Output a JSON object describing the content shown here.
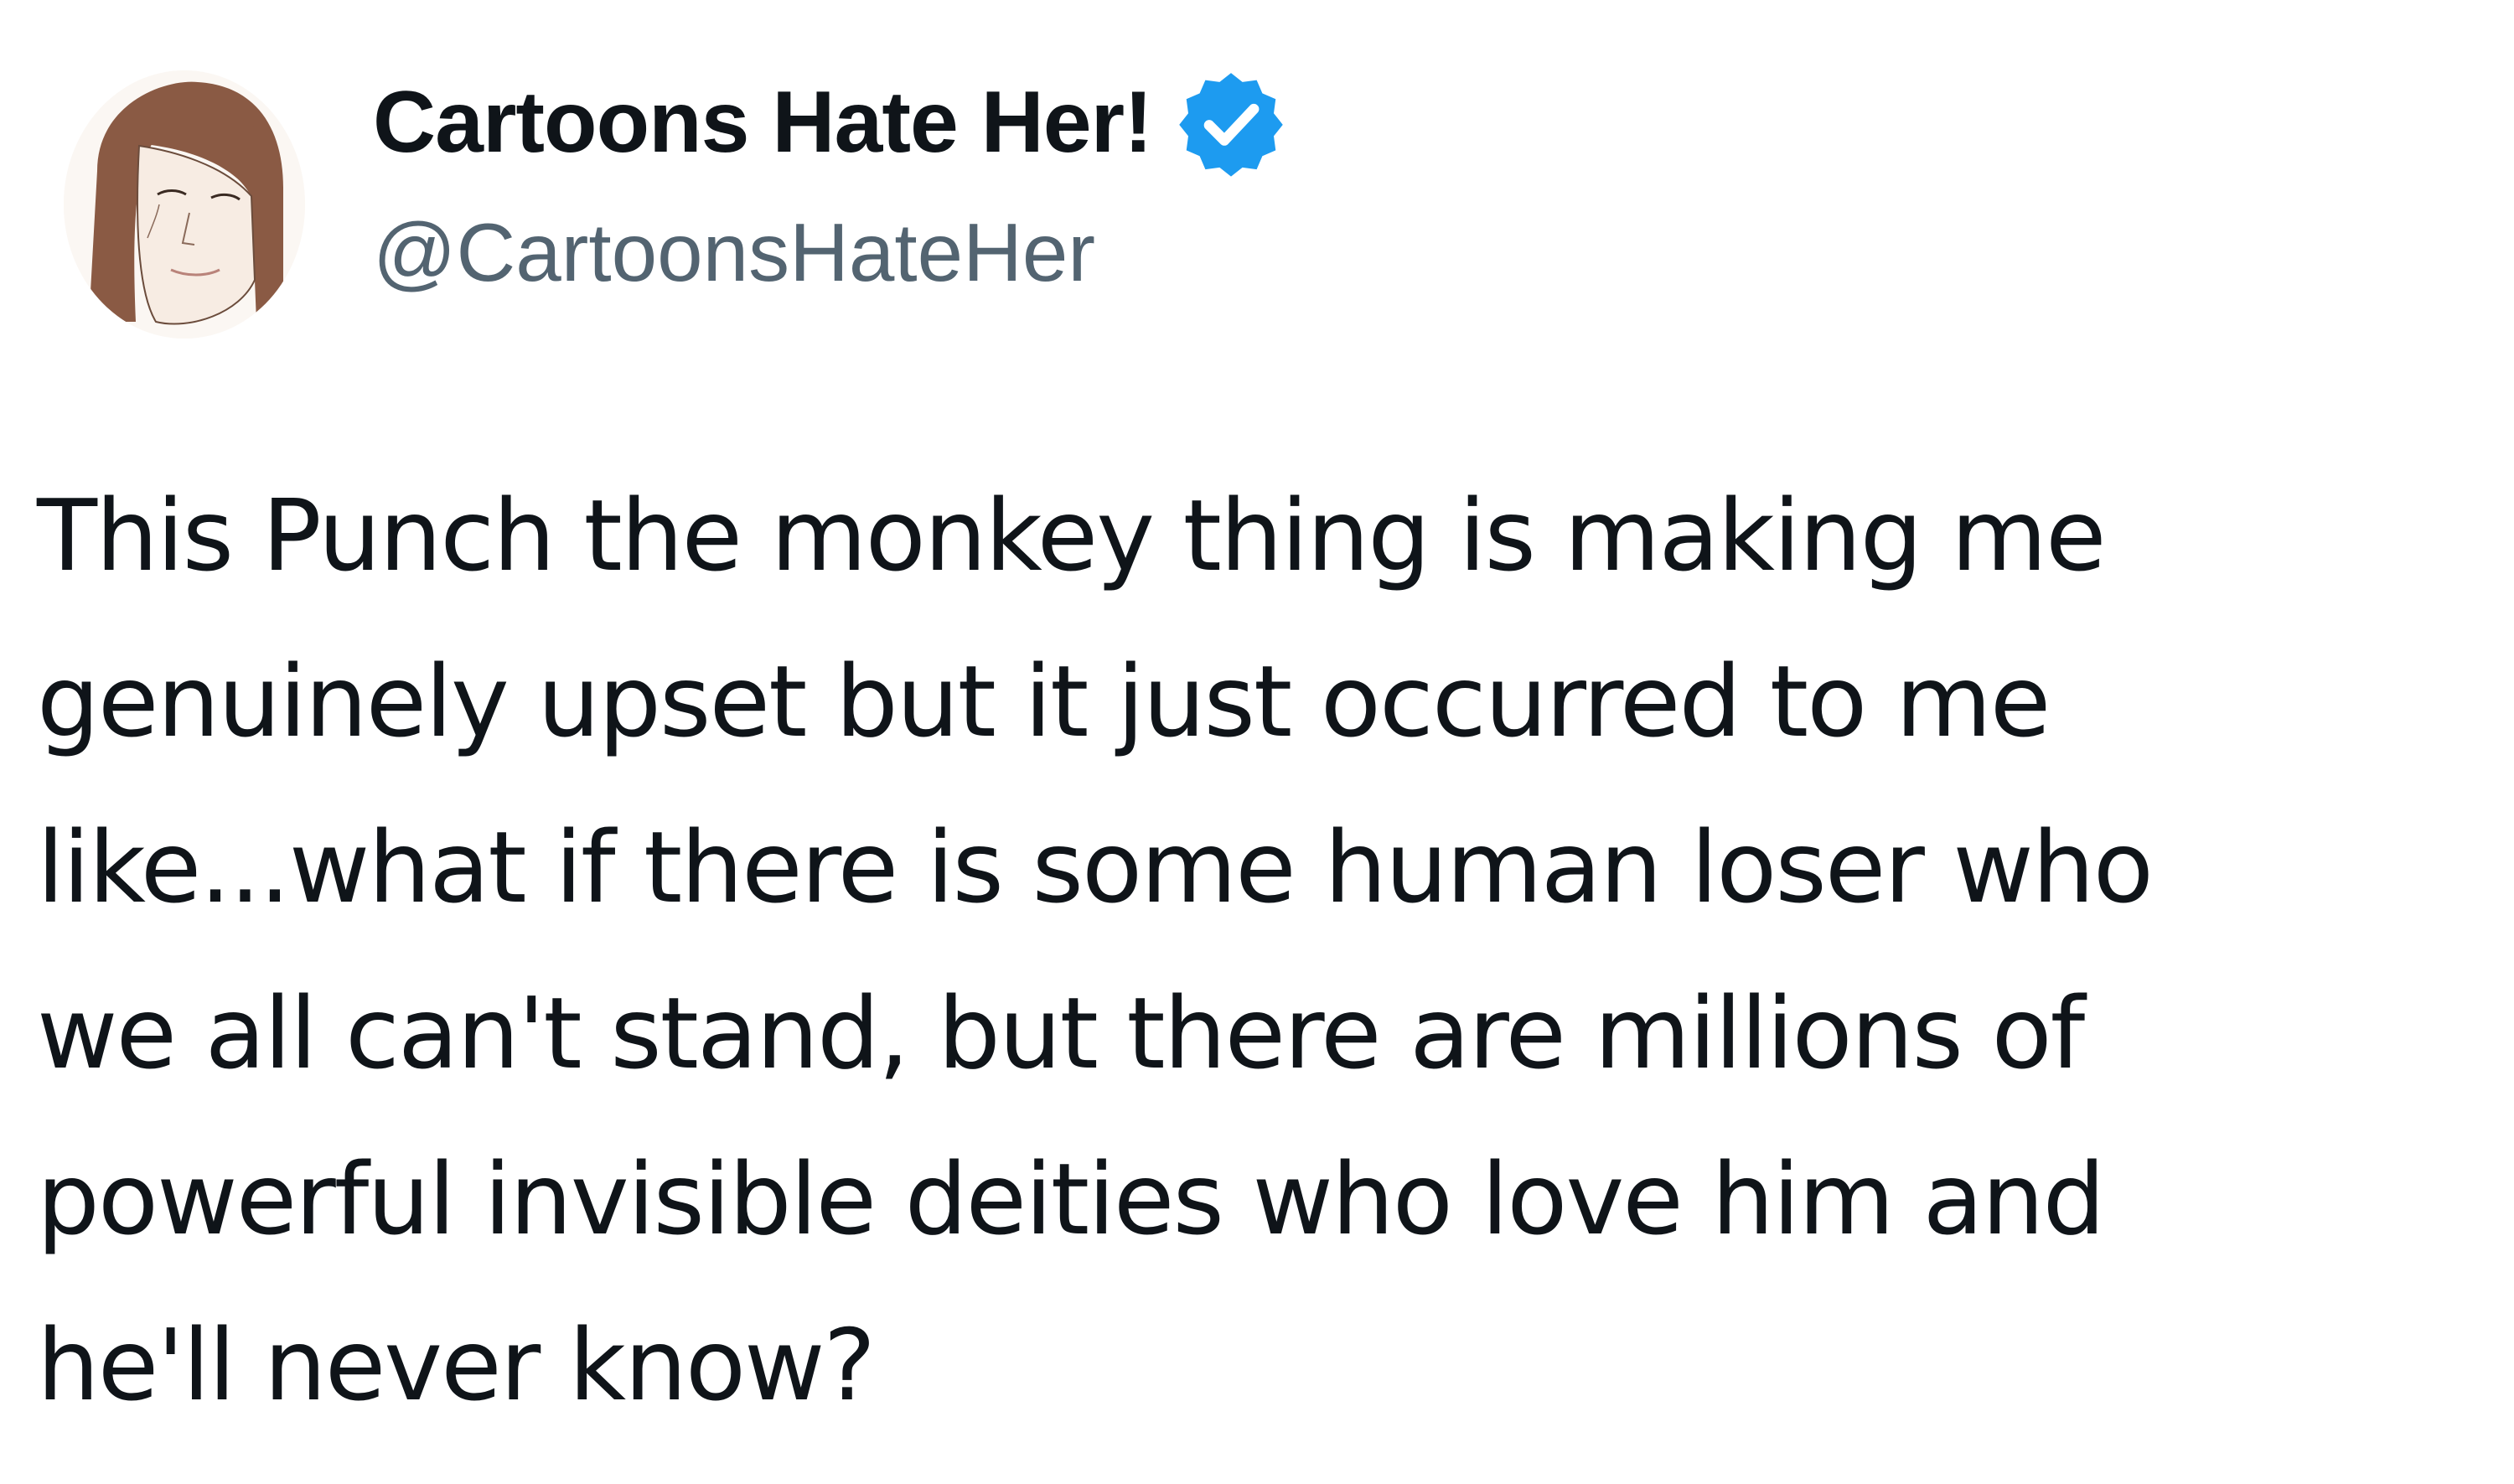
{
  "author": {
    "display_name": "Cartoons Hate Her!",
    "handle": "@CartoonsHateHer",
    "avatar_icon": "cartoon-woman-portrait-avatar",
    "verified_icon": "verified-badge-icon",
    "verified_color": "#1d9bf0"
  },
  "tweet": {
    "lines": [
      "This Punch the monkey thing is making me",
      "genuinely upset but it just occurred to me",
      "like...what if there is some human loser who",
      "we all can't stand, but there are millions of",
      "powerful invisible deities who love him and",
      "he'll never know?"
    ]
  },
  "colors": {
    "text_primary": "#0f1419",
    "text_secondary": "#536471",
    "background": "#ffffff"
  }
}
